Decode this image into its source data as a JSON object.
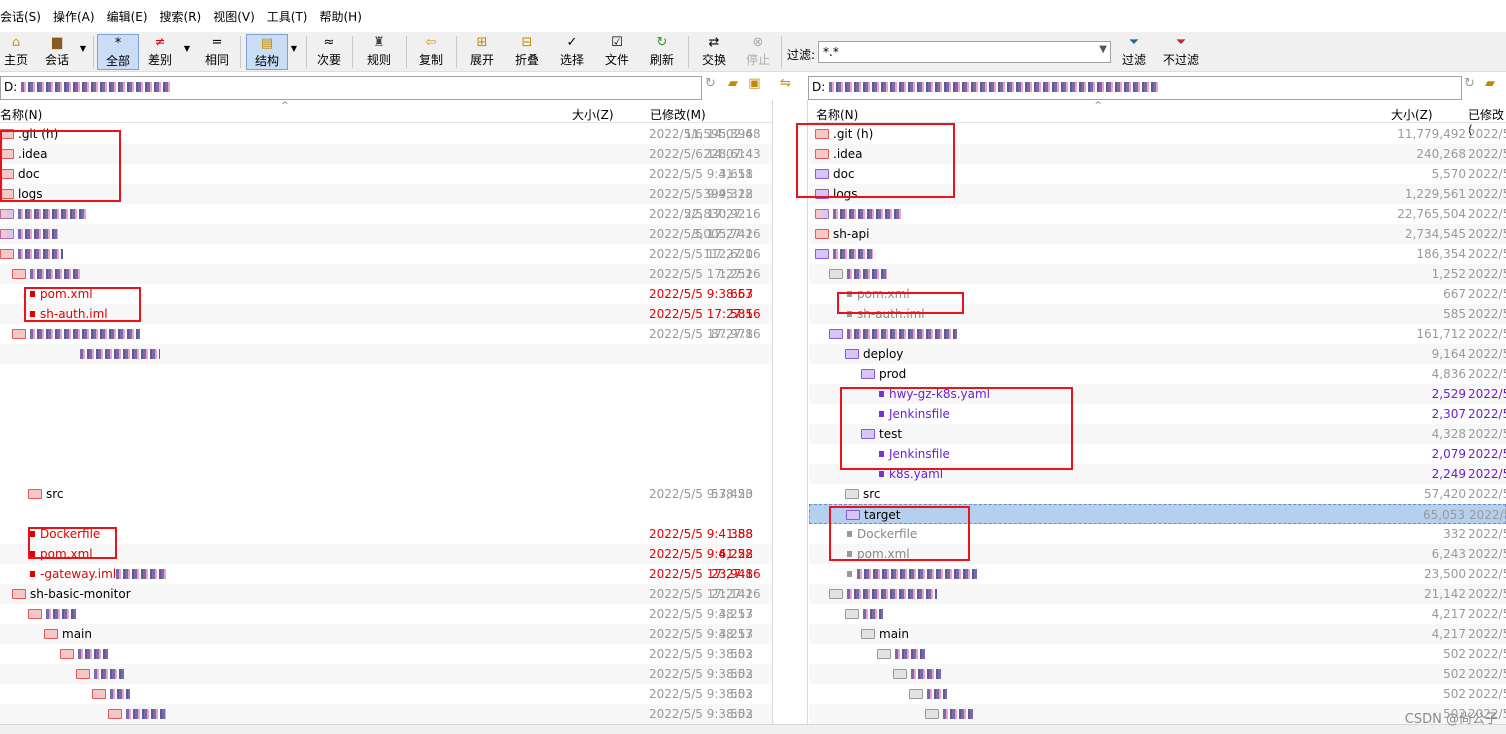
{
  "menu": [
    "会话(S)",
    "操作(A)",
    "编辑(E)",
    "搜索(R)",
    "视图(V)",
    "工具(T)",
    "帮助(H)"
  ],
  "toolbar": {
    "home": "主页",
    "session": "会话",
    "all": "全部",
    "diff": "差别",
    "same": "相同",
    "structure": "结构",
    "minor": "次要",
    "rules": "规则",
    "copy": "复制",
    "expand": "展开",
    "collapse": "折叠",
    "select": "选择",
    "files": "文件",
    "refresh": "刷新",
    "swap": "交换",
    "stop": "停止",
    "filter": "过滤",
    "nofilter": "不过滤"
  },
  "filter": {
    "label": "过滤:",
    "value": "*.*"
  },
  "left_path": "D:",
  "right_path": "D:",
  "columns": {
    "name": "名称(N)",
    "size": "大小(Z)",
    "modified": "已修改(M)",
    "modified_short": "已修改("
  },
  "left_rows": [
    {
      "name": ".git (h)",
      "size": "11,595,396",
      "date": "2022/5/6 14:02:48"
    },
    {
      "name": ".idea",
      "size": "228,614",
      "date": "2022/5/6 14:07:43"
    },
    {
      "name": "doc",
      "size": "3,611",
      "date": "2022/5/5 9:41:58"
    },
    {
      "name": "logs",
      "size": "399,312",
      "date": "2022/5/5 9:45:28"
    },
    {
      "name": "",
      "size": "22,830,921",
      "date": "2022/5/5 17:27:16"
    },
    {
      "name": "",
      "size": "3,005,742",
      "date": "2022/5/5 17:27:16"
    },
    {
      "name": "",
      "size": "112,620",
      "date": "2022/5/5 17:27:16"
    },
    {
      "name": "",
      "size": "1,252",
      "date": "2022/5/5 17:27:16"
    },
    {
      "name": "pom.xml",
      "size": "667",
      "date": "2022/5/5 9:38:53"
    },
    {
      "name": "sh-auth.iml",
      "size": "585",
      "date": "2022/5/5 17:27:16"
    },
    {
      "name": "",
      "size": "87,978",
      "date": "2022/5/5 17:27:16"
    },
    {
      "name": "src",
      "size": "57,420",
      "date": "2022/5/5 9:38:53"
    },
    {
      "name": "Dockerfile",
      "size": "388",
      "date": "2022/5/5 9:41:58"
    },
    {
      "name": "pom.xml",
      "size": "6,222",
      "date": "2022/5/5 9:41:58"
    },
    {
      "name": "-gateway.iml",
      "size": "23,948",
      "date": "2022/5/5 17:27:16"
    },
    {
      "name": "sh-basic-monitor",
      "size": "21,142",
      "date": "2022/5/5 17:27:16"
    },
    {
      "name": "",
      "size": "4,217",
      "date": "2022/5/5 9:38:53"
    },
    {
      "name": "main",
      "size": "4,217",
      "date": "2022/5/5 9:38:53"
    },
    {
      "name": "",
      "size": "502",
      "date": "2022/5/5 9:38:53"
    },
    {
      "name": "",
      "size": "502",
      "date": "2022/5/5 9:38:53"
    },
    {
      "name": "",
      "size": "502",
      "date": "2022/5/5 9:38:53"
    },
    {
      "name": "",
      "size": "502",
      "date": "2022/5/5 9:38:53"
    }
  ],
  "right_rows": [
    {
      "name": ".git (h)",
      "size": "11,779,492",
      "date": "2022/5"
    },
    {
      "name": ".idea",
      "size": "240,268",
      "date": "2022/5"
    },
    {
      "name": "doc",
      "size": "5,570",
      "date": "2022/5"
    },
    {
      "name": "logs",
      "size": "1,229,561",
      "date": "2022/5"
    },
    {
      "name": "",
      "size": "22,765,504",
      "date": "2022/5"
    },
    {
      "name": "sh-api",
      "size": "2,734,545",
      "date": "2022/5"
    },
    {
      "name": "",
      "size": "186,354",
      "date": "2022/5"
    },
    {
      "name": "",
      "size": "1,252",
      "date": "2022/5"
    },
    {
      "name": "pom.xml",
      "size": "667",
      "date": "2022/5"
    },
    {
      "name": "sh-auth.iml",
      "size": "585",
      "date": "2022/5"
    },
    {
      "name": "",
      "size": "161,712",
      "date": "2022/5"
    },
    {
      "name": "deploy",
      "size": "9,164",
      "date": "2022/5"
    },
    {
      "name": "prod",
      "size": "4,836",
      "date": "2022/5"
    },
    {
      "name": "hwy-gz-k8s.yaml",
      "size": "2,529",
      "date": "2022/5"
    },
    {
      "name": "Jenkinsfile",
      "size": "2,307",
      "date": "2022/5"
    },
    {
      "name": "test",
      "size": "4,328",
      "date": "2022/5"
    },
    {
      "name": "Jenkinsfile",
      "size": "2,079",
      "date": "2022/5"
    },
    {
      "name": "k8s.yaml",
      "size": "2,249",
      "date": "2022/5"
    },
    {
      "name": "src",
      "size": "57,420",
      "date": "2022/5"
    },
    {
      "name": "target",
      "size": "65,053",
      "date": "2022/5"
    },
    {
      "name": "Dockerfile",
      "size": "332",
      "date": "2022/5"
    },
    {
      "name": "pom.xml",
      "size": "6,243",
      "date": "2022/5"
    },
    {
      "name": "",
      "size": "23,500",
      "date": "2022/5"
    },
    {
      "name": "",
      "size": "21,142",
      "date": "2022/5"
    },
    {
      "name": "",
      "size": "4,217",
      "date": "2022/5"
    },
    {
      "name": "main",
      "size": "4,217",
      "date": "2022/5"
    },
    {
      "name": "",
      "size": "502",
      "date": "2022/5"
    },
    {
      "name": "",
      "size": "502",
      "date": "2022/5"
    },
    {
      "name": "",
      "size": "502",
      "date": "2022/5"
    },
    {
      "name": "",
      "size": "502",
      "date": "2022/5"
    }
  ],
  "watermark": "CSDN @尚公子"
}
